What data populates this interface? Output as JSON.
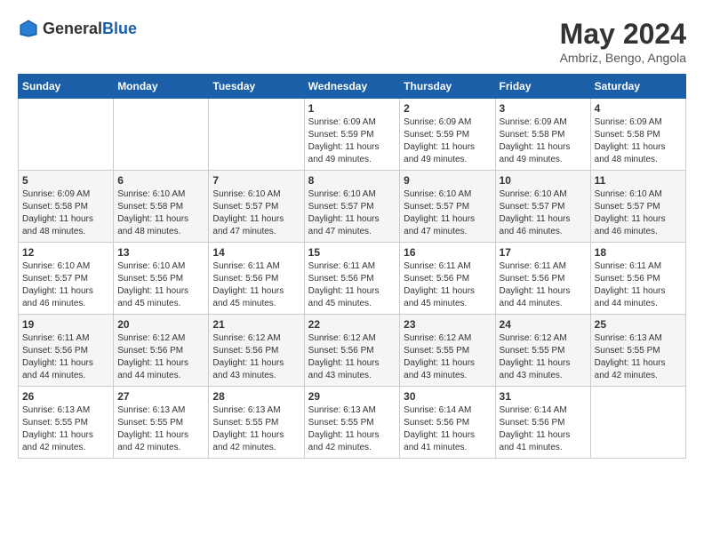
{
  "logo": {
    "general": "General",
    "blue": "Blue"
  },
  "title": {
    "month": "May 2024",
    "location": "Ambriz, Bengo, Angola"
  },
  "days_of_week": [
    "Sunday",
    "Monday",
    "Tuesday",
    "Wednesday",
    "Thursday",
    "Friday",
    "Saturday"
  ],
  "weeks": [
    [
      {
        "day": "",
        "info": ""
      },
      {
        "day": "",
        "info": ""
      },
      {
        "day": "",
        "info": ""
      },
      {
        "day": "1",
        "info": "Sunrise: 6:09 AM\nSunset: 5:59 PM\nDaylight: 11 hours and 49 minutes."
      },
      {
        "day": "2",
        "info": "Sunrise: 6:09 AM\nSunset: 5:59 PM\nDaylight: 11 hours and 49 minutes."
      },
      {
        "day": "3",
        "info": "Sunrise: 6:09 AM\nSunset: 5:58 PM\nDaylight: 11 hours and 49 minutes."
      },
      {
        "day": "4",
        "info": "Sunrise: 6:09 AM\nSunset: 5:58 PM\nDaylight: 11 hours and 48 minutes."
      }
    ],
    [
      {
        "day": "5",
        "info": "Sunrise: 6:09 AM\nSunset: 5:58 PM\nDaylight: 11 hours and 48 minutes."
      },
      {
        "day": "6",
        "info": "Sunrise: 6:10 AM\nSunset: 5:58 PM\nDaylight: 11 hours and 48 minutes."
      },
      {
        "day": "7",
        "info": "Sunrise: 6:10 AM\nSunset: 5:57 PM\nDaylight: 11 hours and 47 minutes."
      },
      {
        "day": "8",
        "info": "Sunrise: 6:10 AM\nSunset: 5:57 PM\nDaylight: 11 hours and 47 minutes."
      },
      {
        "day": "9",
        "info": "Sunrise: 6:10 AM\nSunset: 5:57 PM\nDaylight: 11 hours and 47 minutes."
      },
      {
        "day": "10",
        "info": "Sunrise: 6:10 AM\nSunset: 5:57 PM\nDaylight: 11 hours and 46 minutes."
      },
      {
        "day": "11",
        "info": "Sunrise: 6:10 AM\nSunset: 5:57 PM\nDaylight: 11 hours and 46 minutes."
      }
    ],
    [
      {
        "day": "12",
        "info": "Sunrise: 6:10 AM\nSunset: 5:57 PM\nDaylight: 11 hours and 46 minutes."
      },
      {
        "day": "13",
        "info": "Sunrise: 6:10 AM\nSunset: 5:56 PM\nDaylight: 11 hours and 45 minutes."
      },
      {
        "day": "14",
        "info": "Sunrise: 6:11 AM\nSunset: 5:56 PM\nDaylight: 11 hours and 45 minutes."
      },
      {
        "day": "15",
        "info": "Sunrise: 6:11 AM\nSunset: 5:56 PM\nDaylight: 11 hours and 45 minutes."
      },
      {
        "day": "16",
        "info": "Sunrise: 6:11 AM\nSunset: 5:56 PM\nDaylight: 11 hours and 45 minutes."
      },
      {
        "day": "17",
        "info": "Sunrise: 6:11 AM\nSunset: 5:56 PM\nDaylight: 11 hours and 44 minutes."
      },
      {
        "day": "18",
        "info": "Sunrise: 6:11 AM\nSunset: 5:56 PM\nDaylight: 11 hours and 44 minutes."
      }
    ],
    [
      {
        "day": "19",
        "info": "Sunrise: 6:11 AM\nSunset: 5:56 PM\nDaylight: 11 hours and 44 minutes."
      },
      {
        "day": "20",
        "info": "Sunrise: 6:12 AM\nSunset: 5:56 PM\nDaylight: 11 hours and 44 minutes."
      },
      {
        "day": "21",
        "info": "Sunrise: 6:12 AM\nSunset: 5:56 PM\nDaylight: 11 hours and 43 minutes."
      },
      {
        "day": "22",
        "info": "Sunrise: 6:12 AM\nSunset: 5:56 PM\nDaylight: 11 hours and 43 minutes."
      },
      {
        "day": "23",
        "info": "Sunrise: 6:12 AM\nSunset: 5:55 PM\nDaylight: 11 hours and 43 minutes."
      },
      {
        "day": "24",
        "info": "Sunrise: 6:12 AM\nSunset: 5:55 PM\nDaylight: 11 hours and 43 minutes."
      },
      {
        "day": "25",
        "info": "Sunrise: 6:13 AM\nSunset: 5:55 PM\nDaylight: 11 hours and 42 minutes."
      }
    ],
    [
      {
        "day": "26",
        "info": "Sunrise: 6:13 AM\nSunset: 5:55 PM\nDaylight: 11 hours and 42 minutes."
      },
      {
        "day": "27",
        "info": "Sunrise: 6:13 AM\nSunset: 5:55 PM\nDaylight: 11 hours and 42 minutes."
      },
      {
        "day": "28",
        "info": "Sunrise: 6:13 AM\nSunset: 5:55 PM\nDaylight: 11 hours and 42 minutes."
      },
      {
        "day": "29",
        "info": "Sunrise: 6:13 AM\nSunset: 5:55 PM\nDaylight: 11 hours and 42 minutes."
      },
      {
        "day": "30",
        "info": "Sunrise: 6:14 AM\nSunset: 5:56 PM\nDaylight: 11 hours and 41 minutes."
      },
      {
        "day": "31",
        "info": "Sunrise: 6:14 AM\nSunset: 5:56 PM\nDaylight: 11 hours and 41 minutes."
      },
      {
        "day": "",
        "info": ""
      }
    ]
  ]
}
